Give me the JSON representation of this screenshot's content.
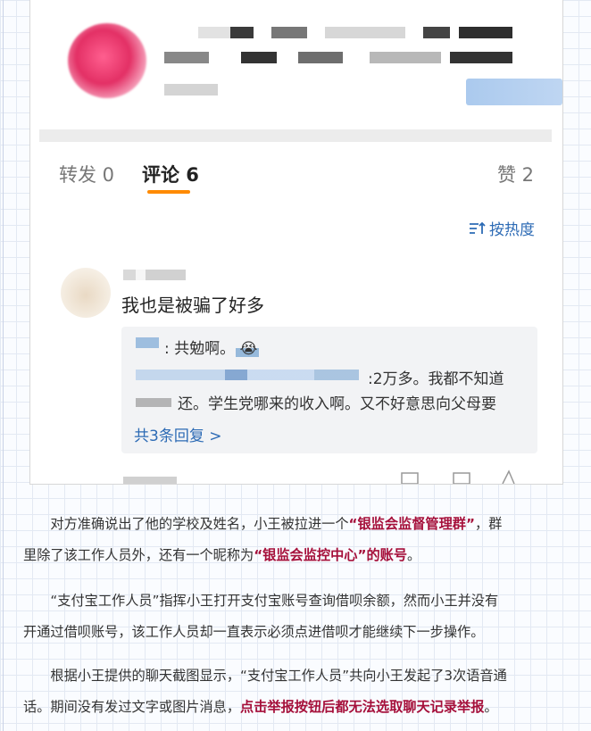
{
  "tabs": [
    {
      "label": "转发 0"
    },
    {
      "label": "评论 6"
    },
    {
      "label": "赞 2"
    }
  ],
  "sort_label": "按热度",
  "comment": {
    "text": "我也是被骗了好多",
    "reply_lines": [
      ": 共勉啊。",
      ":2万多。我都不知道",
      "还。学生党哪来的收入啊。又不好意思向父母要"
    ],
    "more_replies": "共3条回复 >"
  },
  "paragraphs": [
    {
      "lines": [
        [
          {
            "t": "对方准确说出了他的学校及姓名，小王被拉进一个"
          },
          {
            "t": "“银监会监督管理群”",
            "hl": true
          },
          {
            "t": "，群"
          }
        ],
        [
          {
            "t": "里除了该工作人员外，还有一个昵称为"
          },
          {
            "t": "“银监会监控中心”的账号",
            "hl": true
          },
          {
            "t": "。"
          }
        ]
      ]
    },
    {
      "lines": [
        [
          {
            "t": "“支付宝工作人员”指挥小王打开支付宝账号查询借呗余额，然而小王并没有"
          }
        ],
        [
          {
            "t": "开通过借呗账号，该工作人员却一直表示必须点进借呗才能继续下一步操作。"
          }
        ]
      ]
    },
    {
      "lines": [
        [
          {
            "t": "根据小王提供的聊天截图显示，“支付宝工作人员”共向小王发起了3次语音通"
          }
        ],
        [
          {
            "t": "话。期间没有发过文字或图片消息，"
          },
          {
            "t": "点击举报按钮后都无法选取聊天记录举报",
            "hl": true
          },
          {
            "t": "。"
          }
        ]
      ]
    }
  ],
  "colors": {
    "accent_orange": "#ff8a00",
    "link_blue": "#2d6bb5",
    "highlight": "#a50f3a"
  }
}
